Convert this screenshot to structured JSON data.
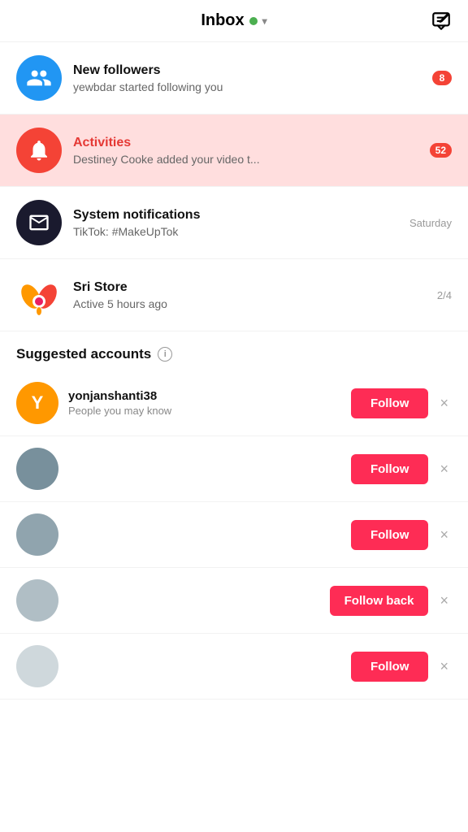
{
  "header": {
    "title": "Inbox",
    "dot_color": "#4caf50",
    "compose_label": "compose"
  },
  "inbox": {
    "items": [
      {
        "id": "new-followers",
        "title": "New followers",
        "subtitle": "yewbdar started following you",
        "badge": "8",
        "avatar_type": "followers",
        "active": false
      },
      {
        "id": "activities",
        "title": "Activities",
        "subtitle": "Destiney Cooke added your video t...",
        "badge": "52",
        "avatar_type": "bell",
        "active": true
      },
      {
        "id": "system-notifications",
        "title": "System notifications",
        "subtitle": "TikTok: #MakeUpTok",
        "time": "Saturday",
        "avatar_type": "system",
        "active": false
      },
      {
        "id": "sri-store",
        "title": "Sri Store",
        "subtitle": "Active 5 hours ago",
        "time": "2/4",
        "avatar_type": "store",
        "active": false
      }
    ]
  },
  "suggested": {
    "section_label": "Suggested accounts",
    "info_icon": "ⓘ",
    "accounts": [
      {
        "username": "yonjanshanti38",
        "description": "People you may know",
        "avatar_letter": "Y",
        "avatar_color": "#FF9800",
        "action": "Follow",
        "action_type": "follow"
      },
      {
        "username": "",
        "description": "",
        "avatar_letter": "",
        "avatar_color": "#9E9E9E",
        "action": "Follow",
        "action_type": "follow"
      },
      {
        "username": "",
        "description": "",
        "avatar_letter": "",
        "avatar_color": "#9E9E9E",
        "action": "Follow",
        "action_type": "follow"
      },
      {
        "username": "",
        "description": "",
        "avatar_letter": "",
        "avatar_color": "#9E9E9E",
        "action": "Follow back",
        "action_type": "follow-back"
      },
      {
        "username": "",
        "description": "",
        "avatar_letter": "",
        "avatar_color": "#9E9E9E",
        "action": "Follow",
        "action_type": "follow"
      }
    ],
    "follow_label": "Follow",
    "follow_back_label": "Follow back",
    "dismiss_label": "×"
  }
}
